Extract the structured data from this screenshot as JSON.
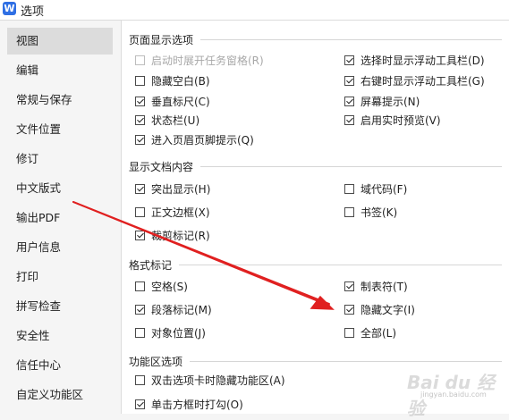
{
  "window": {
    "title": "选项",
    "app_icon_letter": "W"
  },
  "sidebar": {
    "items": [
      {
        "label": "视图"
      },
      {
        "label": "编辑"
      },
      {
        "label": "常规与保存"
      },
      {
        "label": "文件位置"
      },
      {
        "label": "修订"
      },
      {
        "label": "中文版式"
      },
      {
        "label": "输出PDF"
      },
      {
        "label": "用户信息"
      },
      {
        "label": "打印"
      },
      {
        "label": "拼写检查"
      },
      {
        "label": "安全性"
      },
      {
        "label": "信任中心"
      },
      {
        "label": "自定义功能区"
      }
    ],
    "active_index": 0
  },
  "sections": {
    "page_display": {
      "title": "页面显示选项",
      "options": [
        {
          "label": "启动时展开任务窗格(R)",
          "checked": false,
          "disabled": true
        },
        {
          "label": "隐藏空白(B)",
          "checked": false
        },
        {
          "label": "垂直标尺(C)",
          "checked": true
        },
        {
          "label": "状态栏(U)",
          "checked": true
        },
        {
          "label": "进入页眉页脚提示(Q)",
          "checked": true
        },
        {
          "label": "选择时显示浮动工具栏(D)",
          "checked": true
        },
        {
          "label": "右键时显示浮动工具栏(G)",
          "checked": true
        },
        {
          "label": "屏幕提示(N)",
          "checked": true
        },
        {
          "label": "启用实时预览(V)",
          "checked": true
        }
      ]
    },
    "doc_content": {
      "title": "显示文档内容",
      "options": [
        {
          "label": "突出显示(H)",
          "checked": true
        },
        {
          "label": "正文边框(X)",
          "checked": false
        },
        {
          "label": "裁剪标记(R)",
          "checked": true
        },
        {
          "label": "域代码(F)",
          "checked": false
        },
        {
          "label": "书签(K)",
          "checked": false
        }
      ]
    },
    "format_marks": {
      "title": "格式标记",
      "options": [
        {
          "label": "空格(S)",
          "checked": false
        },
        {
          "label": "段落标记(M)",
          "checked": true
        },
        {
          "label": "对象位置(J)",
          "checked": false
        },
        {
          "label": "制表符(T)",
          "checked": true
        },
        {
          "label": "隐藏文字(I)",
          "checked": true
        },
        {
          "label": "全部(L)",
          "checked": false
        }
      ]
    },
    "ribbon": {
      "title": "功能区选项",
      "options": [
        {
          "label": "双击选项卡时隐藏功能区(A)",
          "checked": false
        },
        {
          "label": "单击方框时打勾(O)",
          "checked": true
        }
      ]
    }
  },
  "watermark": {
    "text": "Bai du 经验",
    "sub": "jingyan.baidu.com"
  },
  "colors": {
    "arrow": "#e02020",
    "active_sidebar": "#dcdcdc",
    "app_icon": "#2f6fe4"
  }
}
